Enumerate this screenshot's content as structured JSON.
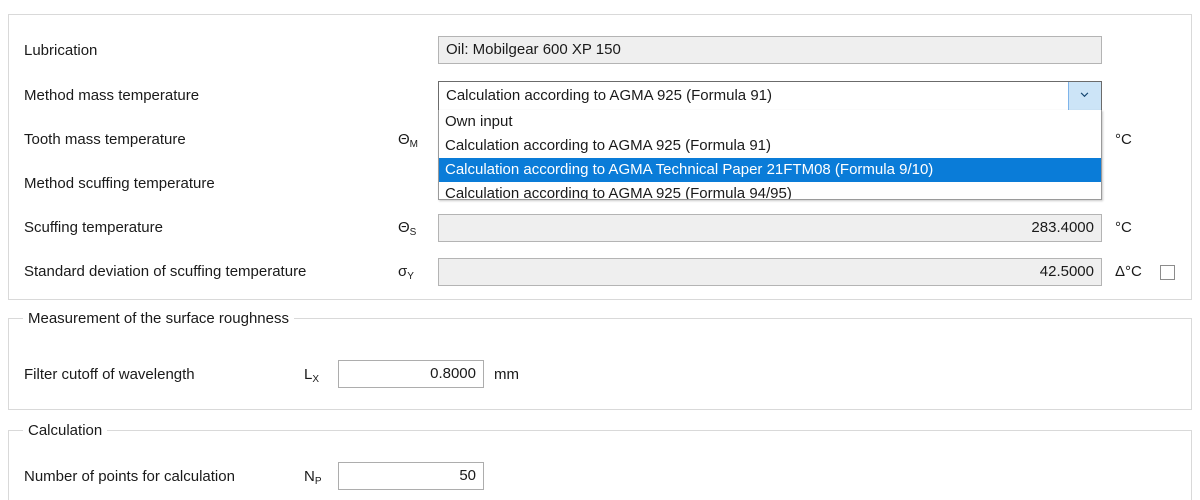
{
  "groups": {
    "lubrication": {
      "legend": ""
    },
    "roughness": {
      "legend": "Measurement of the surface roughness"
    },
    "calculation": {
      "legend": "Calculation"
    }
  },
  "rows": {
    "lubrication": {
      "label": "Lubrication",
      "value": "Oil: Mobilgear 600 XP 150"
    },
    "method_mass_temperature": {
      "label": "Method mass temperature",
      "value": "Calculation according to AGMA 925 (Formula 91)",
      "chevron": "chevron-down-icon"
    },
    "tooth_mass_temperature": {
      "label": "Tooth mass temperature",
      "symbol": "Θ",
      "subscript": "M",
      "value": "",
      "unit": "°C"
    },
    "method_scuffing_temperature": {
      "label": "Method scuffing temperature",
      "value": ""
    },
    "scuffing_temperature": {
      "label": "Scuffing temperature",
      "symbol": "Θ",
      "subscript": "S",
      "value": "283.4000",
      "unit": "°C"
    },
    "standard_deviation_scuffing_temperature": {
      "label": "Standard deviation of scuffing temperature",
      "symbol": "σ",
      "subscript": "Y",
      "value": "42.5000",
      "unit": "Δ°C",
      "checkbox_checked": false
    },
    "filter_cutoff_of_wavelength": {
      "label": "Filter cutoff of wavelength",
      "symbol": "L",
      "subscript": "X",
      "value": "0.8000",
      "unit": "mm"
    },
    "number_of_points_for_calculation": {
      "label": "Number of points for calculation",
      "symbol": "N",
      "subscript": "P",
      "value": "50",
      "unit": ""
    }
  },
  "dropdown": {
    "open": true,
    "items": [
      {
        "label": "Own input",
        "selected": false
      },
      {
        "label": "Calculation according to AGMA 925 (Formula 91)",
        "selected": false
      },
      {
        "label": "Calculation according to AGMA Technical Paper 21FTM08 (Formula 9/10)",
        "selected": true
      },
      {
        "label": "Calculation according to AGMA 925 (Formula 94/95)",
        "selected": false
      }
    ]
  },
  "colors": {
    "highlight": "#0a7cd8",
    "combo_button": "#cce4f7",
    "readonly_field": "#efefef",
    "group_border": "#d9d9d9"
  }
}
